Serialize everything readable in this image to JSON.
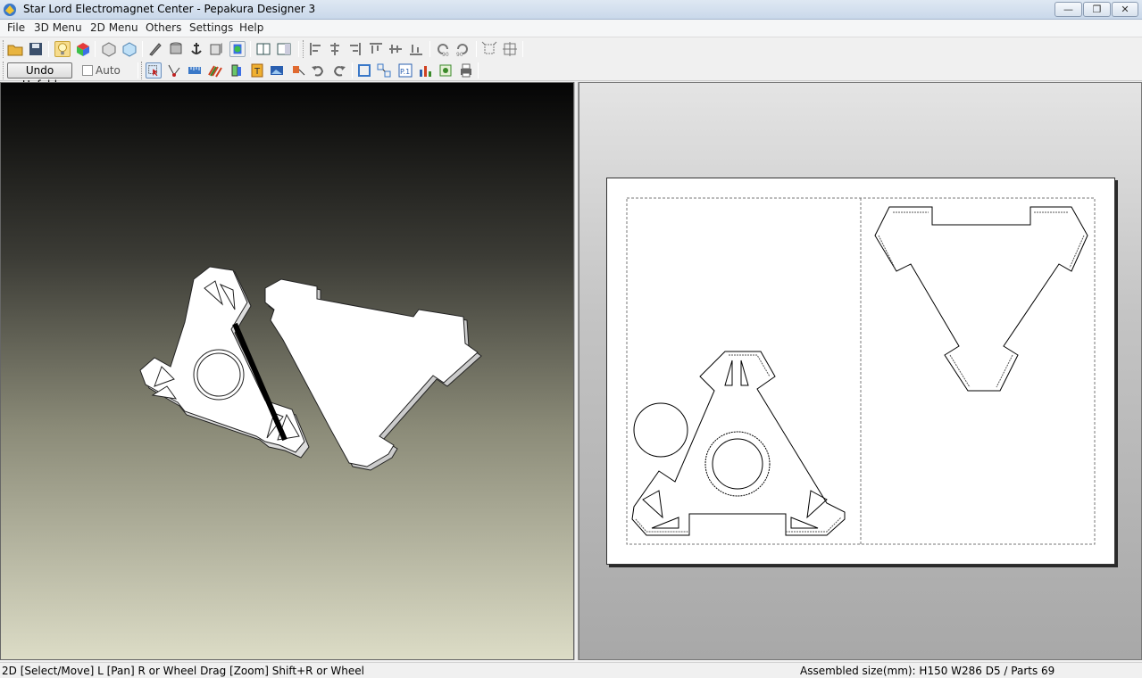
{
  "window": {
    "title": "Star Lord Electromagnet Center - Pepakura Designer 3",
    "minimize": "—",
    "maximize": "❐",
    "close": "✕"
  },
  "menu": [
    "File",
    "3D Menu",
    "2D Menu",
    "Others",
    "Settings",
    "Help"
  ],
  "toolbar2": {
    "undo_unfold": "Undo Unfold",
    "auto_label": "Auto"
  },
  "status": {
    "left": "2D [Select/Move] L [Pan] R or Wheel Drag [Zoom] Shift+R or Wheel",
    "right": "Assembled size(mm): H150 W286 D5 / Parts 69"
  },
  "icons": {
    "toolbar1": [
      "open-folder-icon",
      "save-icon",
      "light-bulb-icon",
      "texture-cube-icon",
      "box-icon",
      "box-light-icon",
      "pencil-icon",
      "cylinder-icon",
      "anchor-icon",
      "edge-icon",
      "paint-icon",
      "single-pane-icon",
      "split-pane-icon",
      "align-left-icon",
      "align-center-icon",
      "align-right-icon",
      "align-top-icon",
      "align-middle-icon",
      "align-bottom-icon",
      "rotate-90-left-icon",
      "rotate-90-right-icon",
      "fit-icon",
      "fit-all-icon"
    ],
    "toolbar2": [
      "select-arrow-icon",
      "join-icon",
      "ruler-icon",
      "pattern-icon",
      "fold-icon",
      "text-icon",
      "image-icon",
      "part-move-icon",
      "undo-icon",
      "redo-icon",
      "frame-icon",
      "arrange-icon",
      "page-number-icon",
      "chart-icon",
      "export-icon",
      "print-icon"
    ]
  },
  "colors": {
    "titlebar": "#dfe8f3",
    "paper_line": "#000000",
    "fold_line": "#555555"
  }
}
